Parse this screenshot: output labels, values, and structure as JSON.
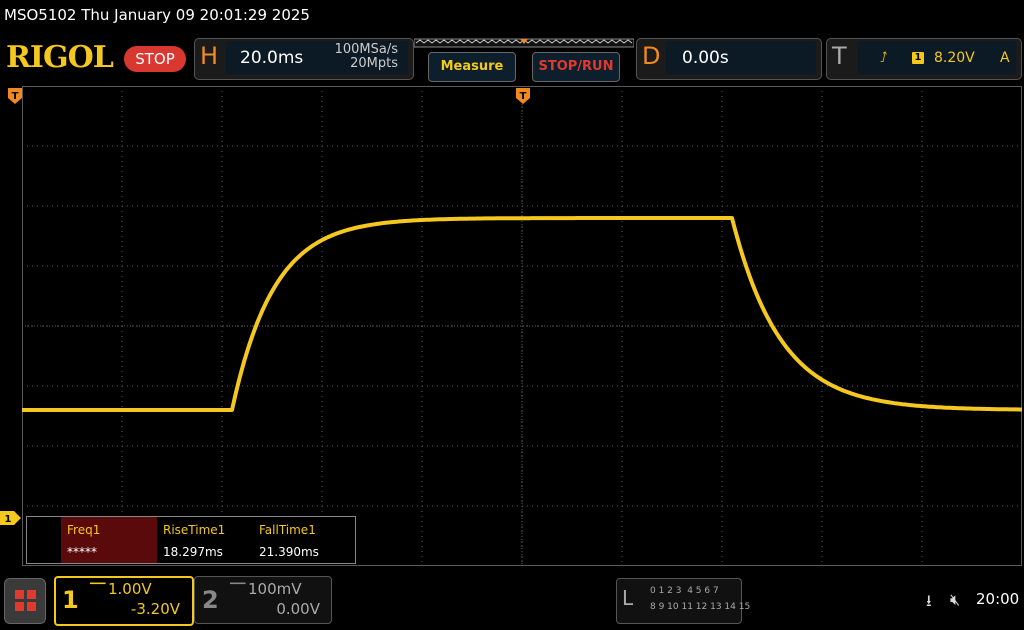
{
  "title": "MSO5102  Thu January 09 20:01:29 2025",
  "logo": "RIGOL",
  "run_state": "STOP",
  "horizontal": {
    "letter": "H",
    "timebase": "20.0ms",
    "sample_rate": "100MSa/s",
    "memory_depth": "20Mpts"
  },
  "buttons": {
    "measure": "Measure",
    "stop_run": "STOP/RUN"
  },
  "delay": {
    "letter": "D",
    "value": "0.00s"
  },
  "trigger": {
    "letter": "T",
    "edge_icon": "rising-edge-icon",
    "source": "1",
    "level": "8.20V",
    "mode": "A"
  },
  "markers": {
    "trigger_position": "T",
    "channel1": "1"
  },
  "measurements": [
    {
      "name": "Freq1",
      "value": "*****",
      "selected": true
    },
    {
      "name": "RiseTime1",
      "value": "18.297ms",
      "selected": false
    },
    {
      "name": "FallTime1",
      "value": "21.390ms",
      "selected": false
    }
  ],
  "channels": [
    {
      "num": "1",
      "scale": "1.00V",
      "offset": "-3.20V",
      "active": true,
      "color": "#f4c81e"
    },
    {
      "num": "2",
      "scale": "100mV",
      "offset": "0.00V",
      "active": false,
      "color": "#888888"
    }
  ],
  "la": {
    "letter": "L",
    "row1": "0 1 2 3  4 5 6 7",
    "row2": "8 9 10 11 12 13 14 15"
  },
  "status": {
    "time": "20:00"
  },
  "colors": {
    "trace": "#f4c81e",
    "accent": "#f08a20",
    "stop": "#d8382f",
    "grid": "#5a5a5a"
  },
  "waveform": {
    "time_per_div_ms": 20,
    "volts_per_div": 1.0,
    "baseline_div": -1.4,
    "high_div": 1.8,
    "rise_start_ms": -58,
    "fall_start_ms": 42,
    "rise_time_ms": 18.297,
    "fall_time_ms": 21.39
  }
}
